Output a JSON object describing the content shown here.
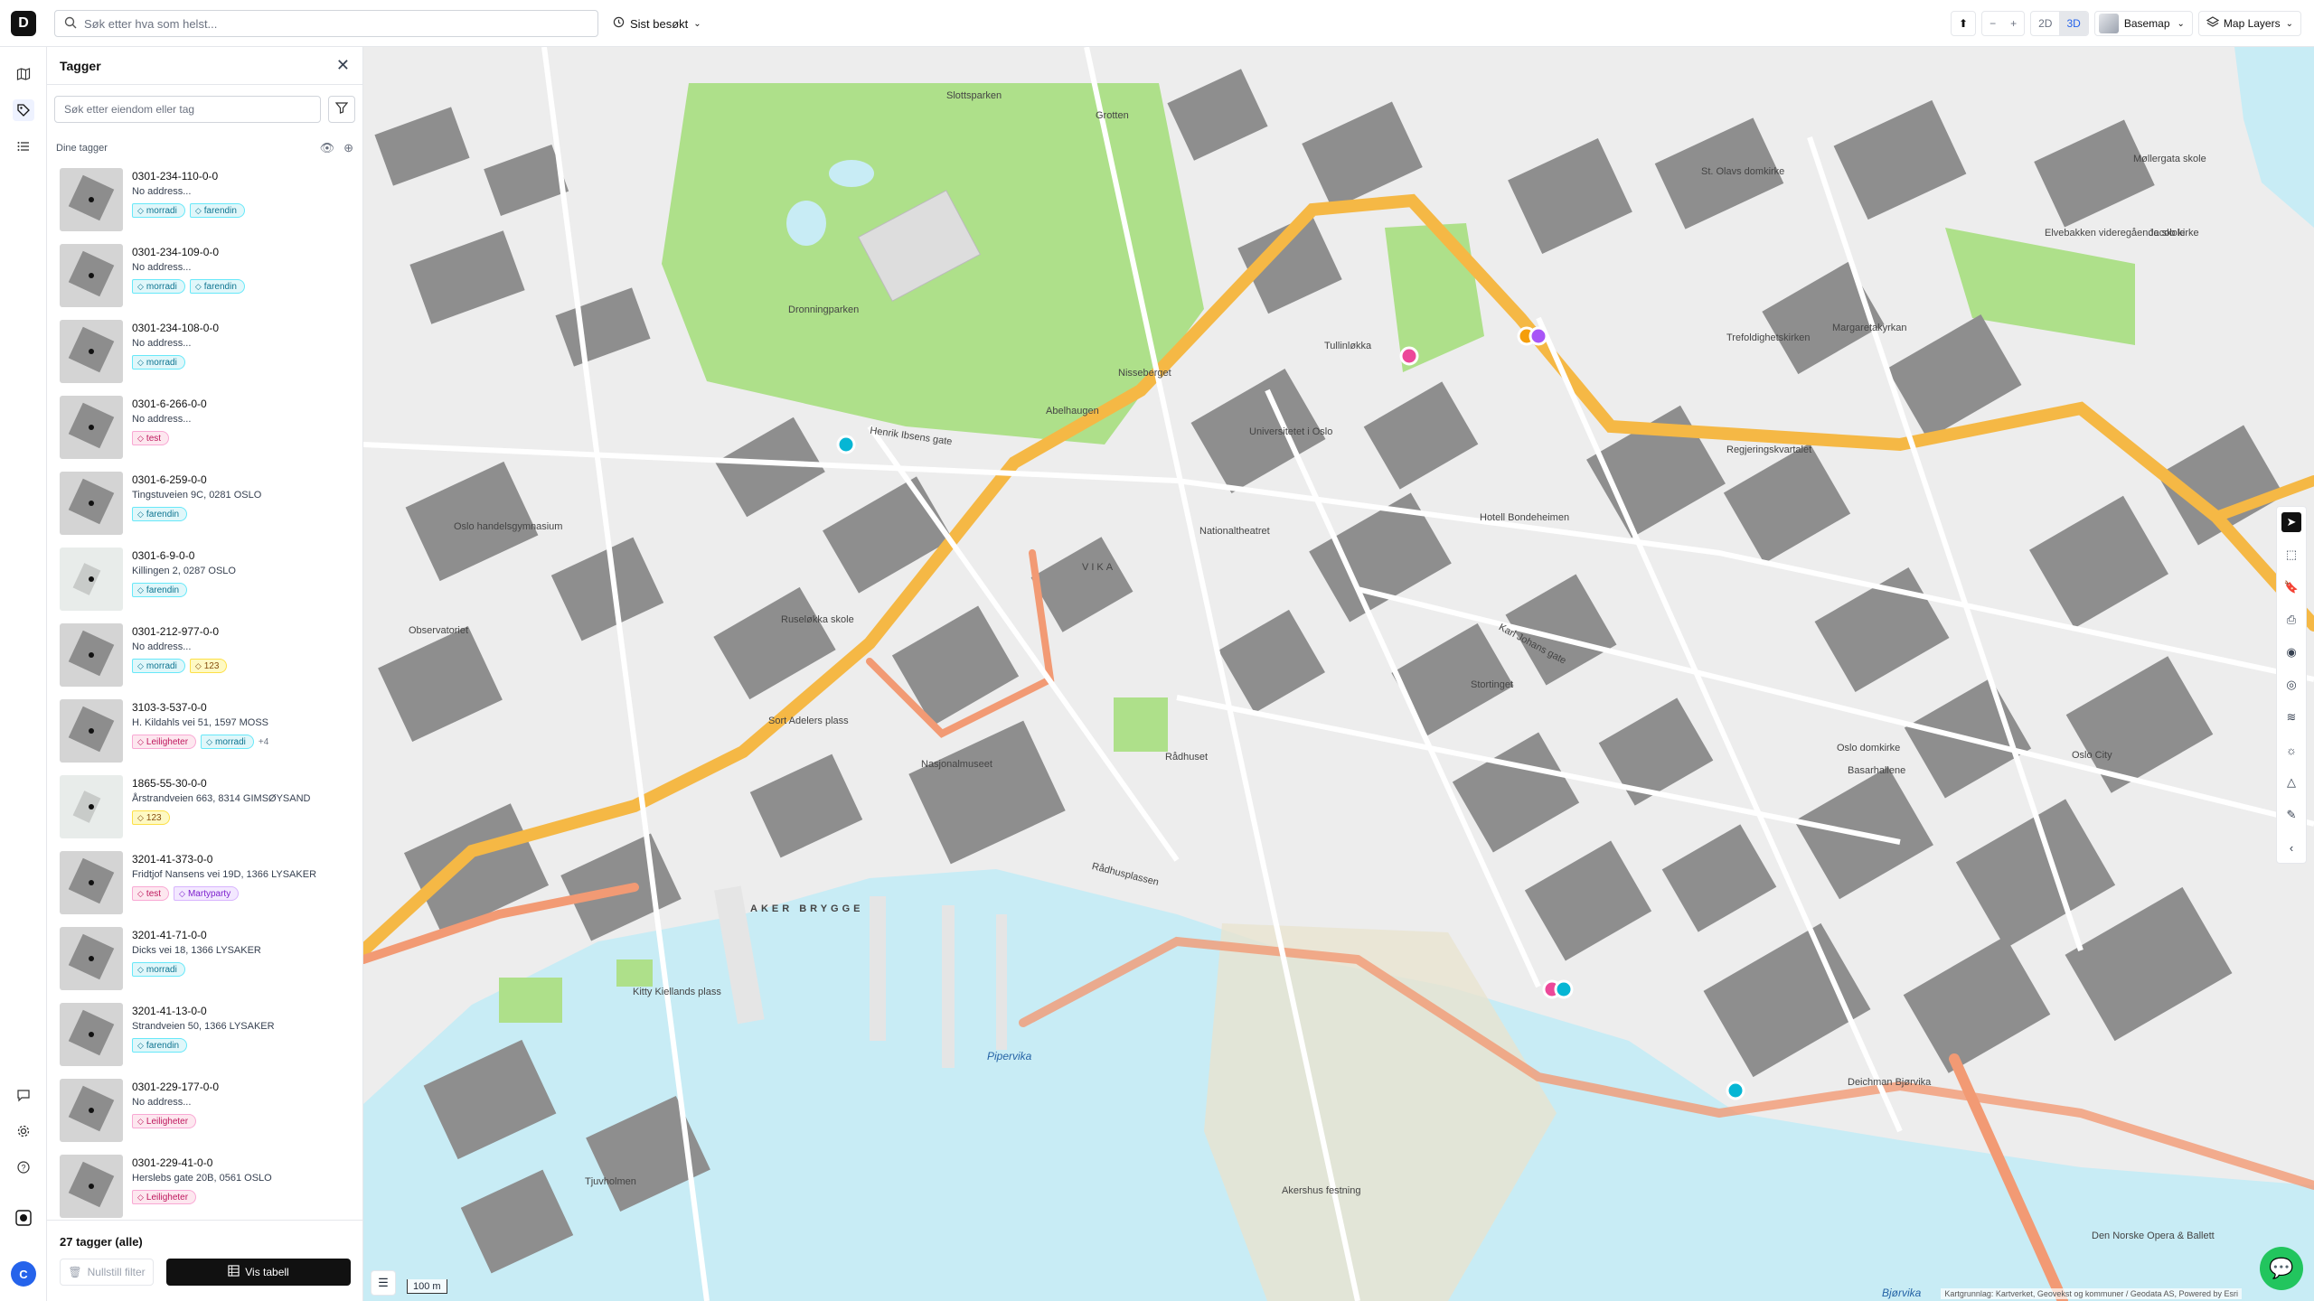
{
  "topbar": {
    "logo": "D",
    "search_placeholder": "Søk etter hva som helst...",
    "recent_label": "Sist besøkt",
    "view_2d": "2D",
    "view_3d": "3D",
    "basemap_label": "Basemap",
    "layers_label": "Map Layers"
  },
  "panel": {
    "title": "Tagger",
    "search_placeholder": "Søk etter eiendom eller tag",
    "list_header": "Dine tagger",
    "items": [
      {
        "id": "0301-234-110-0-0",
        "address": "No address...",
        "tags": [
          {
            "label": "morradi",
            "color": "cyan"
          },
          {
            "label": "farendin",
            "color": "cyan"
          }
        ]
      },
      {
        "id": "0301-234-109-0-0",
        "address": "No address...",
        "tags": [
          {
            "label": "morradi",
            "color": "cyan"
          },
          {
            "label": "farendin",
            "color": "cyan"
          }
        ]
      },
      {
        "id": "0301-234-108-0-0",
        "address": "No address...",
        "tags": [
          {
            "label": "morradi",
            "color": "cyan"
          }
        ]
      },
      {
        "id": "0301-6-266-0-0",
        "address": "No address...",
        "tags": [
          {
            "label": "test",
            "color": "pink"
          }
        ]
      },
      {
        "id": "0301-6-259-0-0",
        "address": "Tingstuveien 9C, 0281 OSLO",
        "tags": [
          {
            "label": "farendin",
            "color": "cyan"
          }
        ]
      },
      {
        "id": "0301-6-9-0-0",
        "address": "Killingen 2, 0287 OSLO",
        "tags": [
          {
            "label": "farendin",
            "color": "cyan"
          }
        ]
      },
      {
        "id": "0301-212-977-0-0",
        "address": "No address...",
        "tags": [
          {
            "label": "morradi",
            "color": "cyan"
          },
          {
            "label": "123",
            "color": "yellow"
          }
        ]
      },
      {
        "id": "3103-3-537-0-0",
        "address": "H. Kildahls vei 51, 1597 MOSS",
        "tags": [
          {
            "label": "Leiligheter",
            "color": "pink"
          },
          {
            "label": "morradi",
            "color": "cyan"
          }
        ],
        "more": "+4"
      },
      {
        "id": "1865-55-30-0-0",
        "address": "Årstrandveien 663, 8314 GIMSØYSAND",
        "tags": [
          {
            "label": "123",
            "color": "yellow"
          }
        ]
      },
      {
        "id": "3201-41-373-0-0",
        "address": "Fridtjof Nansens vei 19D, 1366 LYSAKER",
        "tags": [
          {
            "label": "test",
            "color": "pink"
          },
          {
            "label": "Martyparty",
            "color": "purple"
          }
        ]
      },
      {
        "id": "3201-41-71-0-0",
        "address": "Dicks vei 18, 1366 LYSAKER",
        "tags": [
          {
            "label": "morradi",
            "color": "cyan"
          }
        ]
      },
      {
        "id": "3201-41-13-0-0",
        "address": "Strandveien 50, 1366 LYSAKER",
        "tags": [
          {
            "label": "farendin",
            "color": "cyan"
          }
        ]
      },
      {
        "id": "0301-229-177-0-0",
        "address": "No address...",
        "tags": [
          {
            "label": "Leiligheter",
            "color": "pink"
          }
        ]
      },
      {
        "id": "0301-229-41-0-0",
        "address": "Herslebs gate 20B, 0561 OSLO",
        "tags": [
          {
            "label": "Leiligheter",
            "color": "pink"
          }
        ]
      }
    ],
    "count_label": "27 tagger (alle)",
    "reset_label": "Nullstill filter",
    "table_label": "Vis tabell"
  },
  "rail": {
    "avatar": "C"
  },
  "map": {
    "labels": [
      "Slottsparken",
      "Dronningparken",
      "Nisseberget",
      "Abelhaugen",
      "Universitetet i Oslo",
      "Nationaltheatret",
      "Tullinløkka",
      "VIKA",
      "Ruseløkka skole",
      "Observatoriet",
      "Nasjonalmuseet",
      "Rådhuset",
      "Stortinget",
      "Regjeringskvartalet",
      "Oslo domkirke",
      "Basarhallene",
      "Oslo City",
      "AKER BRYGGE",
      "Kitty Kiellands plass",
      "Tjuvholmen",
      "Akershus festning",
      "Deichman Bjørvika",
      "Den Norske Opera & Ballett",
      "Margaretakyrkan",
      "Trefoldighetskirken",
      "St. Olavs domkirke",
      "Elvebakken videregående skole",
      "Jacob kirke",
      "Hotell Bondeheimen",
      "Karl Johans gate",
      "Henrik Ibsens gate",
      "Rådhusplassen",
      "Sort Adelers plass",
      "Oslo handelsgymnasium",
      "Grotten",
      "Møllergata skole"
    ],
    "water_labels": [
      "Pipervika",
      "Bjørvika"
    ],
    "scale": "100 m",
    "attribution": "Kartgrunnlag: Kartverket, Geovekst og kommuner / Geodata AS, Powered by Esri",
    "colors": {
      "water": "#c8ecf5",
      "park": "#aee08a",
      "building": "#8e8e8e",
      "main_road": "#f5b845",
      "tram": "#f29a74"
    }
  }
}
